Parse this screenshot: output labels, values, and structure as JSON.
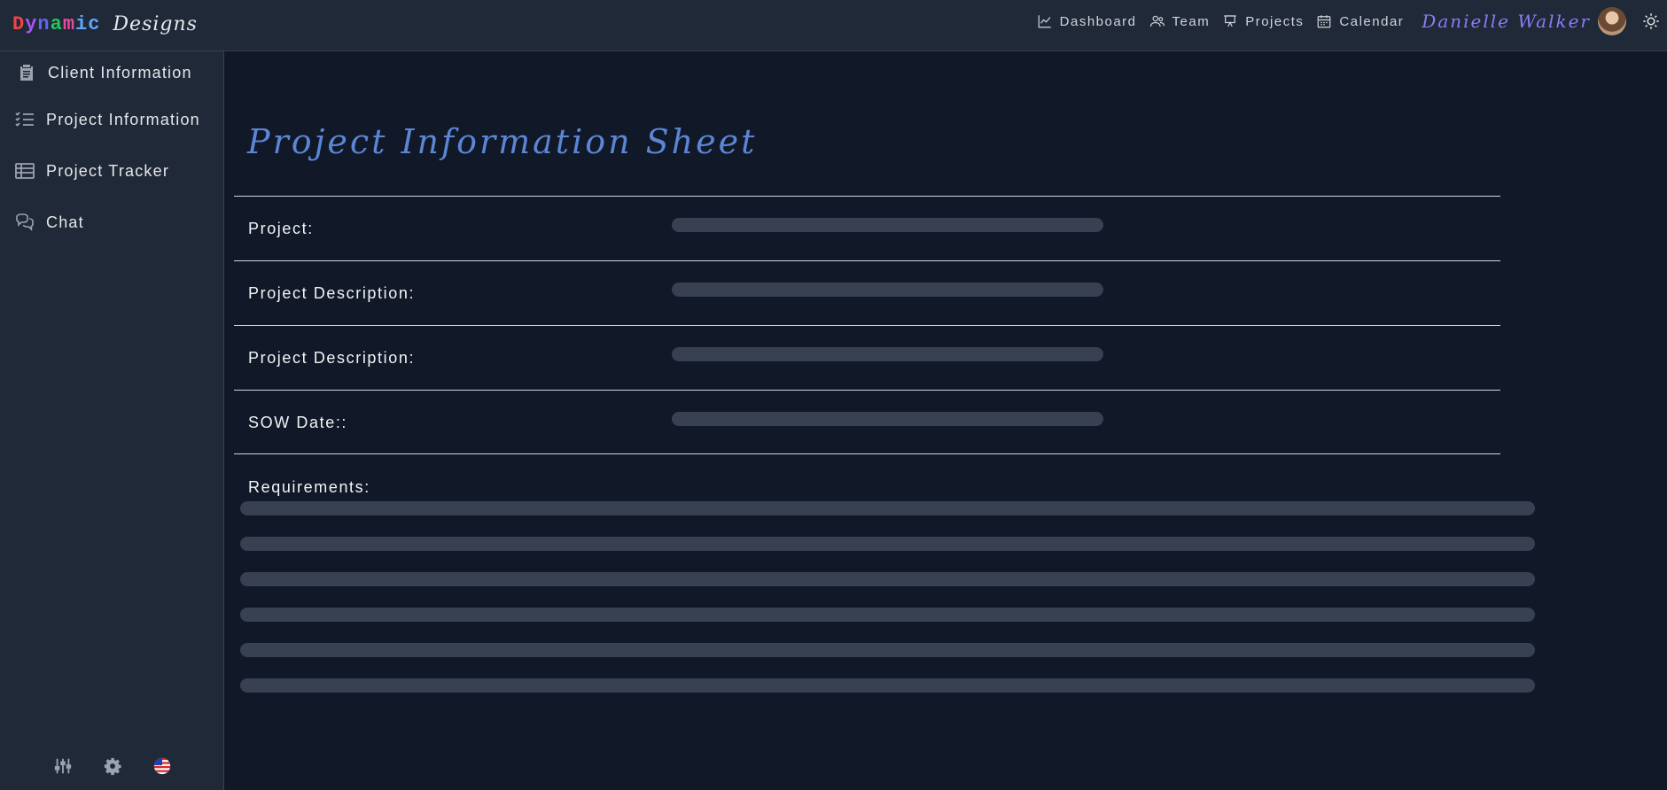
{
  "app": {
    "logo_word1": "Dynamic",
    "logo_word1_letters": [
      {
        "ch": "D",
        "color": "#ef4444"
      },
      {
        "ch": "y",
        "color": "#a855f7"
      },
      {
        "ch": "n",
        "color": "#6366f1"
      },
      {
        "ch": "a",
        "color": "#22c55e"
      },
      {
        "ch": "m",
        "color": "#ec4899"
      },
      {
        "ch": "i",
        "color": "#60a5fa"
      },
      {
        "ch": "c",
        "color": "#60a5fa"
      }
    ],
    "logo_word2": "Designs"
  },
  "topnav": {
    "items": [
      {
        "label": "Dashboard",
        "icon": "chart-line-icon"
      },
      {
        "label": "Team",
        "icon": "users-icon"
      },
      {
        "label": "Projects",
        "icon": "presentation-icon"
      },
      {
        "label": "Calendar",
        "icon": "calendar-icon"
      }
    ],
    "user_name": "Danielle Walker",
    "theme_icon": "sun-icon"
  },
  "sidebar": {
    "items": [
      {
        "label": "Client Information",
        "icon": "clipboard-icon"
      },
      {
        "label": "Project Information",
        "icon": "checklist-icon"
      },
      {
        "label": "Project Tracker",
        "icon": "table-icon"
      },
      {
        "label": "Chat",
        "icon": "chat-bubbles-icon"
      }
    ],
    "bottom_icons": [
      "sliders-icon",
      "gear-icon",
      "us-flag-icon"
    ]
  },
  "main": {
    "title": "Project Information Sheet",
    "fields": [
      {
        "label": "Project:"
      },
      {
        "label": "Project Description:"
      },
      {
        "label": "Project Description:"
      },
      {
        "label": "SOW Date::"
      }
    ],
    "requirements_label": "Requirements:"
  },
  "colors": {
    "accent": "#5b86d6",
    "username": "#8b7cf6",
    "placeholder": "#374151",
    "background": "#111827",
    "panel": "#1f2937"
  }
}
